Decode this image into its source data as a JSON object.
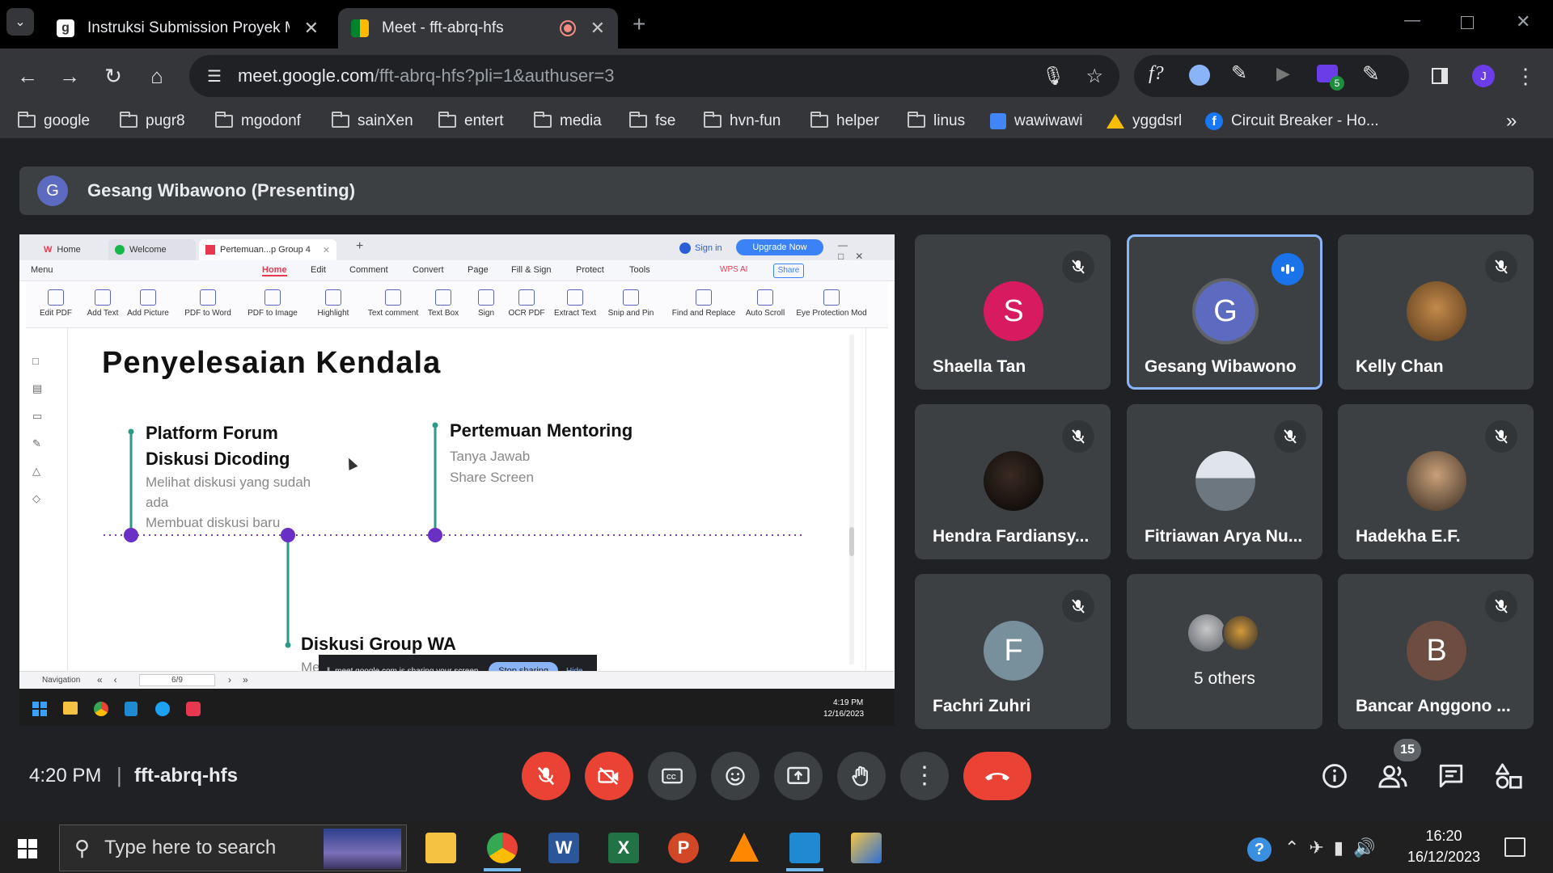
{
  "browser": {
    "tabs": [
      {
        "title": "Instruksi Submission Proyek Me",
        "active": false
      },
      {
        "title": "Meet - fft-abrq-hfs",
        "active": true
      }
    ],
    "url_host": "meet.google.com",
    "url_path": "/fft-abrq-hfs?pli=1&authuser=3",
    "extension_badge": "5",
    "profile_initial": "J",
    "bookmarks": [
      "google",
      "pugr8",
      "mgodonf",
      "sainXen",
      "entert",
      "media",
      "fse",
      "hvn-fun",
      "helper",
      "linus",
      "wawiwawi",
      "yggdsrl",
      "Circuit Breaker - Ho..."
    ]
  },
  "meet": {
    "presenter_initial": "G",
    "presenting_label": "Gesang Wibawono (Presenting)",
    "participants": [
      {
        "name": "Shaella Tan",
        "initial": "S",
        "color": "#d81b60",
        "muted": true,
        "speaking": false
      },
      {
        "name": "Gesang Wibawono",
        "initial": "G",
        "color": "#5c6bc0",
        "muted": false,
        "speaking": true
      },
      {
        "name": "Kelly Chan",
        "initial": "",
        "color": "#8d5a2b",
        "muted": true,
        "speaking": false
      },
      {
        "name": "Hendra Fardiansy...",
        "initial": "",
        "color": "#111111",
        "muted": true,
        "speaking": false
      },
      {
        "name": "Fitriawan Arya Nu...",
        "initial": "",
        "color": "#9aa4ae",
        "muted": true,
        "speaking": false
      },
      {
        "name": "Hadekha E.F.",
        "initial": "",
        "color": "#5a4a3a",
        "muted": true,
        "speaking": false
      },
      {
        "name": "Fachri Zuhri",
        "initial": "F",
        "color": "#78909c",
        "muted": true,
        "speaking": false
      },
      {
        "name": "5 others",
        "initial": "",
        "color": "#3c4043",
        "muted": false,
        "speaking": false
      },
      {
        "name": "Bancar Anggono ...",
        "initial": "B",
        "color": "#6d4c41",
        "muted": true,
        "speaking": false
      }
    ],
    "time": "4:20 PM",
    "separator": "|",
    "meeting_code": "fft-abrq-hfs",
    "people_count": "15"
  },
  "shared_screen": {
    "tabs": [
      "Home",
      "Welcome",
      "Pertemuan...p Group 4"
    ],
    "sign_in": "Sign in",
    "upgrade": "Upgrade Now",
    "menu": [
      "Menu",
      "Home",
      "Edit",
      "Comment",
      "Convert",
      "Page",
      "Fill & Sign",
      "Protect",
      "Tools"
    ],
    "wps_ai": "WPS AI",
    "share": "Share",
    "ribbon": [
      "Edit PDF",
      "Add Text",
      "Add Picture",
      "PDF to Word",
      "PDF to Image",
      "Highlight",
      "Text comment",
      "Text Box",
      "Sign",
      "OCR PDF",
      "Extract Text",
      "Snip and Pin",
      "Find and Replace",
      "Auto Scroll",
      "Eye Protection Mod"
    ],
    "slide": {
      "title": "Penyelesaian Kendala",
      "item1_title_l1": "Platform Forum",
      "item1_title_l2": "Diskusi Dicoding",
      "item1_desc_l1": "Melihat diskusi yang sudah",
      "item1_desc_l2": "ada",
      "item1_desc_l3": "Membuat diskusi baru",
      "item2_title": "Pertemuan Mentoring",
      "item2_desc_l1": "Tanya Jawab",
      "item2_desc_l2": "Share Screen",
      "item3_title": "Diskusi Group WA",
      "item3_desc": "Me"
    },
    "sharing_text": "meet.google.com is sharing your screen.",
    "stop_sharing": "Stop sharing",
    "hide": "Hide",
    "navigation": "Navigation",
    "page": "6/9",
    "clock_time": "4:19 PM",
    "clock_date": "12/16/2023"
  },
  "taskbar": {
    "search_placeholder": "Type here to search",
    "time": "16:20",
    "date": "16/12/2023"
  }
}
